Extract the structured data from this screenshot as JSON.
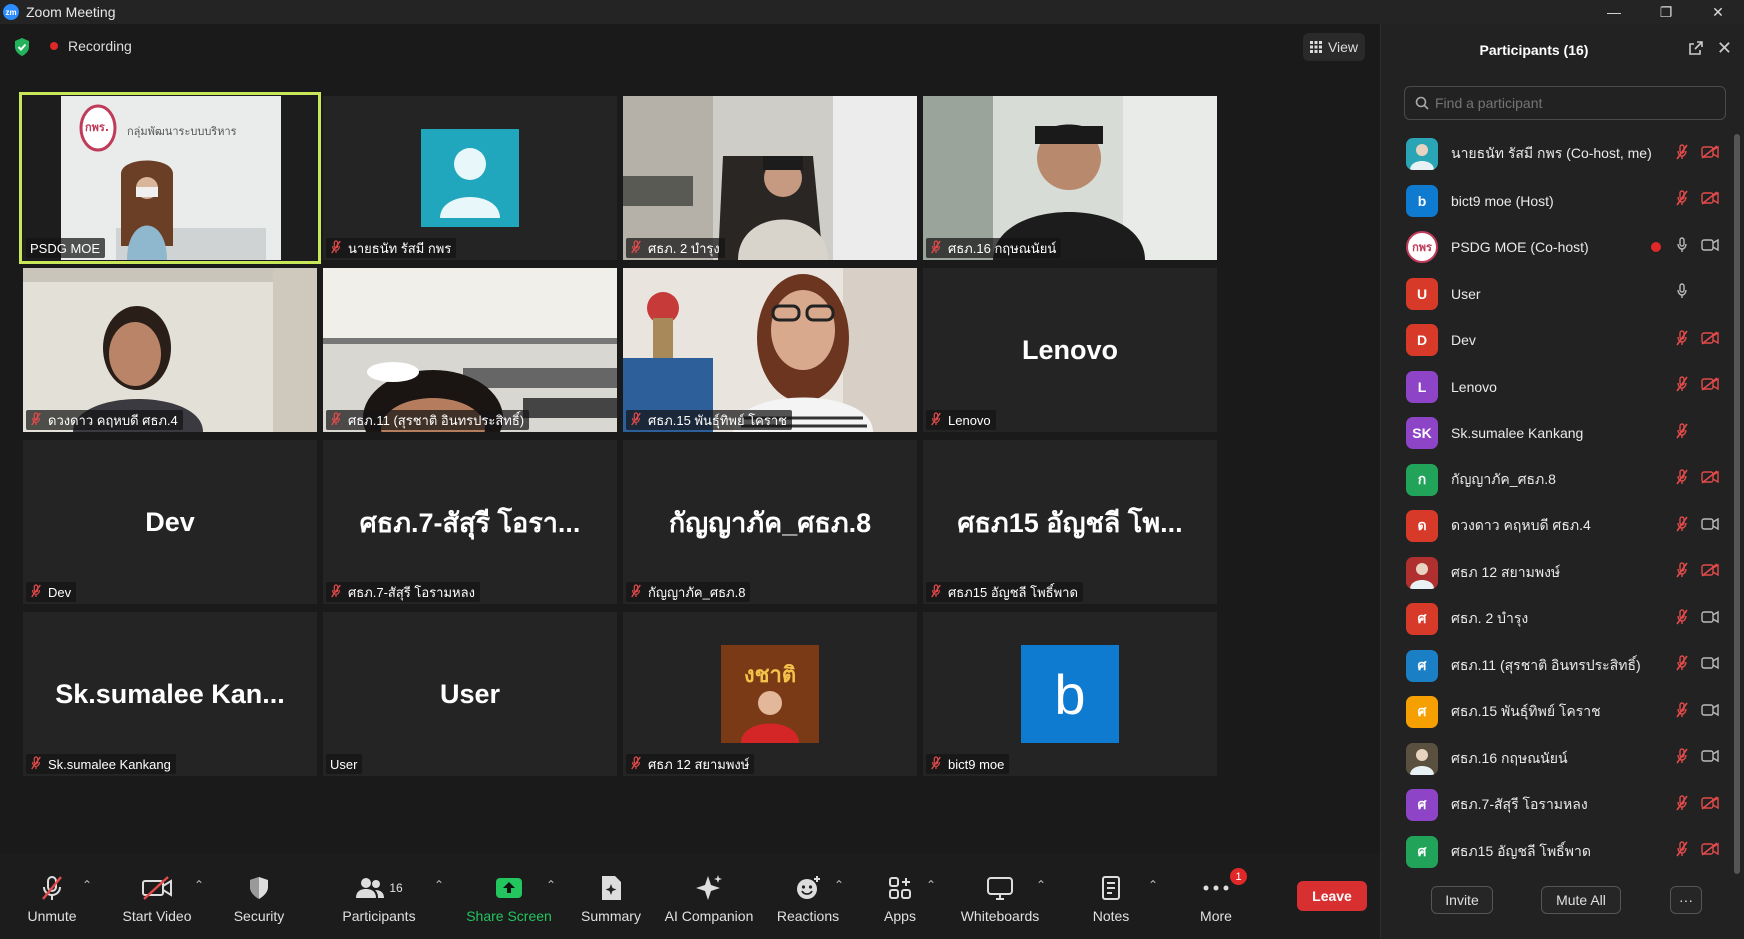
{
  "window": {
    "title": "Zoom Meeting",
    "logo_text": "zm"
  },
  "topbar": {
    "recording_label": "Recording",
    "view_label": "View"
  },
  "tiles": [
    {
      "name": "PSDG MOE",
      "display": "",
      "muted": false
    },
    {
      "name": "นายธนัท รัสมี กพร",
      "display": "",
      "muted": true
    },
    {
      "name": "ศธภ. 2 บำรุง",
      "display": "",
      "muted": true
    },
    {
      "name": "ศธภ.16 กฤษณนัยน์",
      "display": "",
      "muted": true
    },
    {
      "name": "ดวงดาว คฤหบดี ศธภ.4",
      "display": "",
      "muted": true
    },
    {
      "name": "ศธภ.11 (สุรชาติ อินทรประสิทธิ์)",
      "display": "",
      "muted": true
    },
    {
      "name": "ศธภ.15 พันธุ์ทิพย์ โคราช",
      "display": "",
      "muted": true
    },
    {
      "name": "Lenovo",
      "display": "Lenovo",
      "muted": true
    },
    {
      "name": "Dev",
      "display": "Dev",
      "muted": true
    },
    {
      "name": "ศธภ.7-สัสุรี โอรามหลง",
      "display": "ศธภ.7-สัสุรี โอรา...",
      "muted": true
    },
    {
      "name": "กัญญาภัค_ศธภ.8",
      "display": "กัญญาภัค_ศธภ.8",
      "muted": true
    },
    {
      "name": "ศธภ15 อัญชลี โพธิ์พาด",
      "display": "ศธภ15 อัญชลี โพ...",
      "muted": true
    },
    {
      "name": "Sk.sumalee Kankang",
      "display": "Sk.sumalee  Kan...",
      "muted": true
    },
    {
      "name": "User",
      "display": "User",
      "muted": false
    },
    {
      "name": "ศธภ 12 สยามพงษ์",
      "display": "",
      "muted": true
    },
    {
      "name": "bict9 moe",
      "display": "",
      "avatar_letter": "b",
      "muted": true
    }
  ],
  "tile0_sign": "กลุ่มพัฒนาระบบบริหาร",
  "tile0_logo": "กพร.",
  "tile14_banner": "งชาติ",
  "toolbar": {
    "unmute": "Unmute",
    "start_video": "Start Video",
    "security": "Security",
    "participants": "Participants",
    "participants_count": "16",
    "share_screen": "Share Screen",
    "summary": "Summary",
    "ai_companion": "AI Companion",
    "reactions": "Reactions",
    "apps": "Apps",
    "whiteboards": "Whiteboards",
    "notes": "Notes",
    "more": "More",
    "more_badge": "1",
    "leave": "Leave"
  },
  "panel": {
    "title": "Participants (16)",
    "search_placeholder": "Find a participant",
    "invite": "Invite",
    "mute_all": "Mute All",
    "more": "···",
    "participants": [
      {
        "name": "นายธนัท รัสมี กพร (Co-host, me)",
        "avatar": "",
        "color": "#2aa5b5",
        "mic": "muted",
        "cam": "off",
        "rec": false
      },
      {
        "name": "bict9 moe (Host)",
        "avatar": "b",
        "color": "#0e7ad0",
        "mic": "muted",
        "cam": "off",
        "rec": false
      },
      {
        "name": "PSDG MOE (Co-host)",
        "avatar": "กพร",
        "color": "#ffffff",
        "mic": "on",
        "cam": "on",
        "rec": true
      },
      {
        "name": "User",
        "avatar": "U",
        "color": "#d83a2a",
        "mic": "on",
        "cam": "none",
        "rec": false
      },
      {
        "name": "Dev",
        "avatar": "D",
        "color": "#d83a2a",
        "mic": "muted",
        "cam": "off",
        "rec": false
      },
      {
        "name": "Lenovo",
        "avatar": "L",
        "color": "#8e44c6",
        "mic": "muted",
        "cam": "off",
        "rec": false
      },
      {
        "name": "Sk.sumalee Kankang",
        "avatar": "SK",
        "color": "#8e44c6",
        "mic": "muted",
        "cam": "none",
        "rec": false
      },
      {
        "name": "กัญญาภัค_ศธภ.8",
        "avatar": "ก",
        "color": "#22a35a",
        "mic": "muted",
        "cam": "off",
        "rec": false
      },
      {
        "name": "ดวงดาว คฤหบดี ศธภ.4",
        "avatar": "ด",
        "color": "#d83a2a",
        "mic": "muted",
        "cam": "on",
        "rec": false
      },
      {
        "name": "ศธภ 12 สยามพงษ์",
        "avatar": "",
        "color": "#b03030",
        "mic": "muted",
        "cam": "off",
        "rec": false
      },
      {
        "name": "ศธภ. 2 บำรุง",
        "avatar": "ศ",
        "color": "#d83a2a",
        "mic": "muted",
        "cam": "on",
        "rec": false
      },
      {
        "name": "ศธภ.11 (สุรชาติ อินทรประสิทธิ์)",
        "avatar": "ศ",
        "color": "#1a7fc4",
        "mic": "muted",
        "cam": "on",
        "rec": false
      },
      {
        "name": "ศธภ.15 พันธุ์ทิพย์ โคราช",
        "avatar": "ศ",
        "color": "#f5a000",
        "mic": "muted",
        "cam": "on",
        "rec": false
      },
      {
        "name": "ศธภ.16 กฤษณนัยน์",
        "avatar": "",
        "color": "#5a5040",
        "mic": "muted",
        "cam": "on",
        "rec": false
      },
      {
        "name": "ศธภ.7-สัสุรี โอรามหลง",
        "avatar": "ศ",
        "color": "#8e44c6",
        "mic": "muted",
        "cam": "off",
        "rec": false
      },
      {
        "name": "ศธภ15 อัญชลี โพธิ์พาด",
        "avatar": "ศ",
        "color": "#22a35a",
        "mic": "muted",
        "cam": "off",
        "rec": false
      }
    ]
  },
  "colors": {
    "speaking": "#c8e85a",
    "leave": "#d83030",
    "share": "#22c55e",
    "mute": "#e24b4b"
  }
}
